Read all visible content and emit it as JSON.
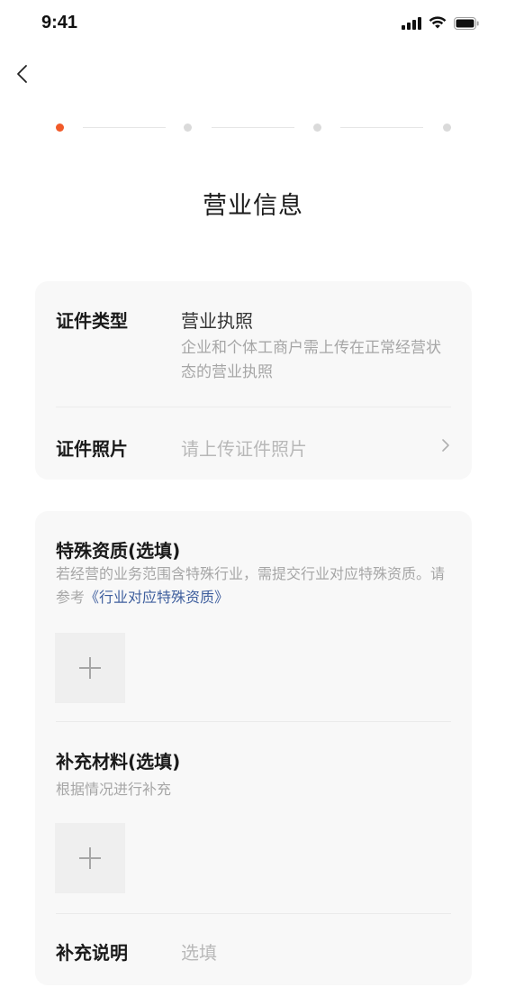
{
  "status_bar": {
    "time": "9:41",
    "icons": [
      "signal-icon",
      "wifi-icon",
      "battery-icon"
    ]
  },
  "nav": {
    "back_icon": "chevron-left-icon"
  },
  "stepper": {
    "total_steps": 4,
    "current_step": 1,
    "active_color": "#f15a29"
  },
  "page": {
    "title": "营业信息"
  },
  "license_card": {
    "type_label": "证件类型",
    "type_value": "营业执照",
    "type_desc": "企业和个体工商户需上传在正常经营状态的营业执照",
    "photo_label": "证件照片",
    "photo_placeholder": "请上传证件照片"
  },
  "extra_card": {
    "qualification": {
      "title": "特殊资质(选填)",
      "desc_prefix": "若经营的业务范围含特殊行业，需提交行业对应特殊资质。请参考",
      "desc_link": "《行业对应特殊资质》"
    },
    "supplement": {
      "title": "补充材料(选填)",
      "desc": "根据情况进行补充"
    },
    "note": {
      "label": "补充说明",
      "placeholder": "选填"
    }
  },
  "colors": {
    "accent": "#f15a29",
    "link": "#3f5f9e",
    "card_bg": "#f8f8f8",
    "muted_text": "#a6a6a6"
  }
}
